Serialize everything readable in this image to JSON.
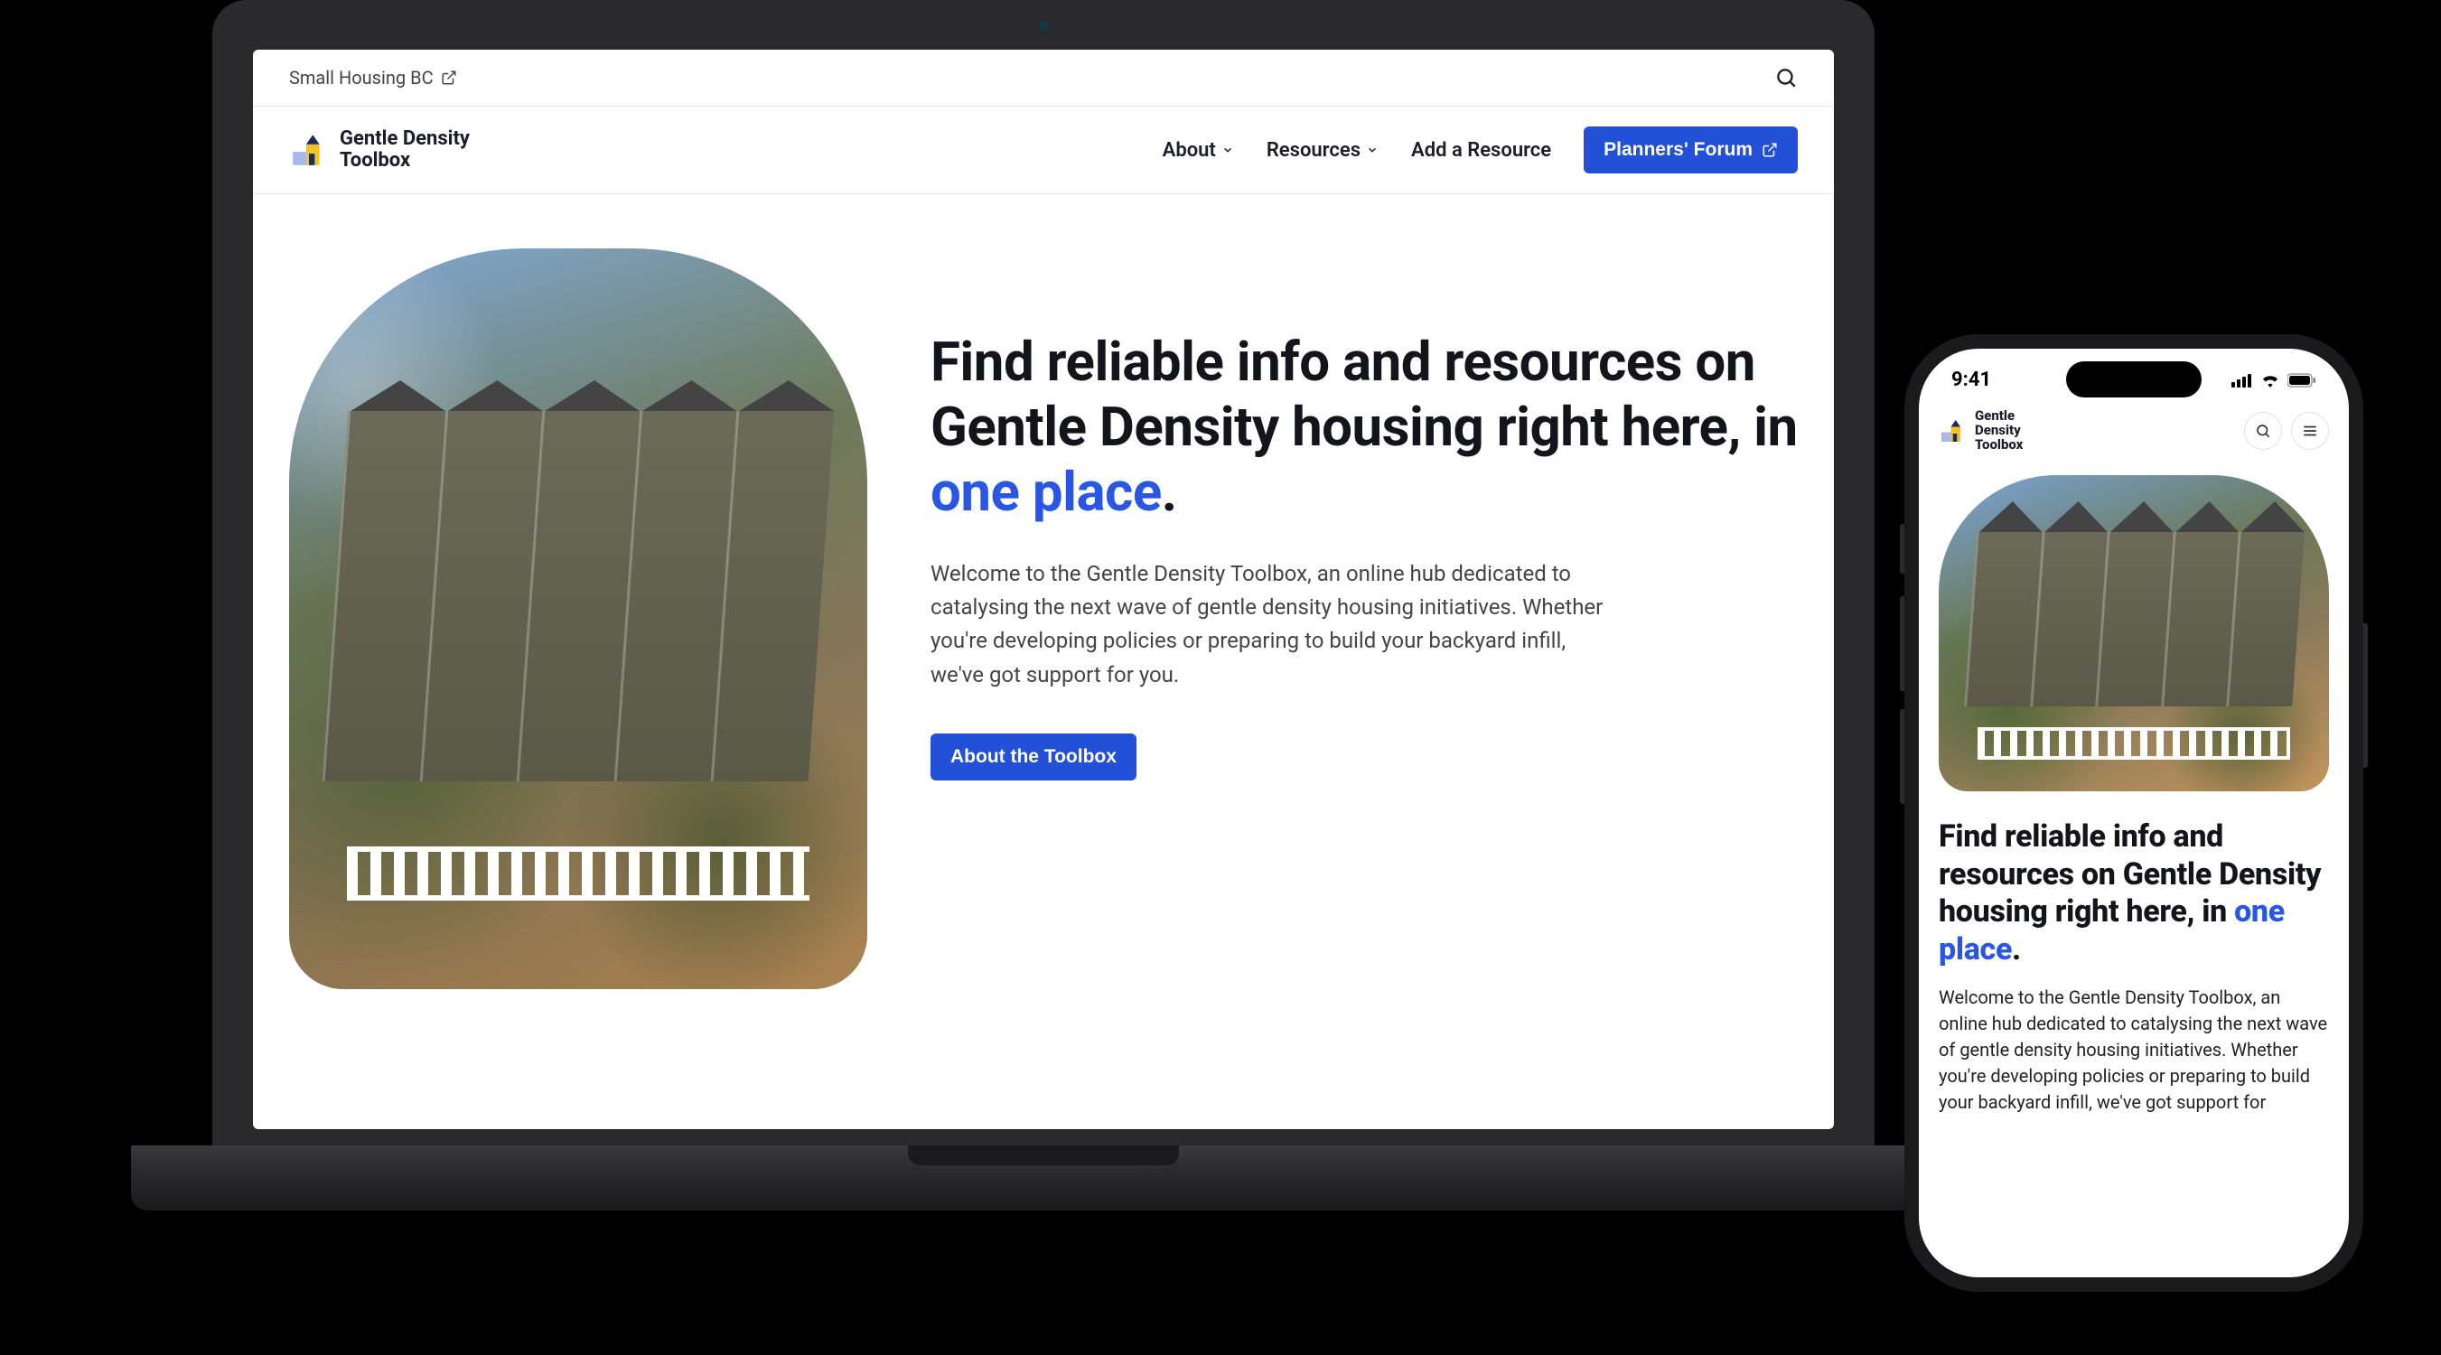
{
  "topbar": {
    "parent_org": "Small Housing BC"
  },
  "brand": {
    "line1": "Gentle Density",
    "line2": "Toolbox"
  },
  "nav": {
    "about": "About",
    "resources": "Resources",
    "add_resource": "Add a Resource",
    "planners_forum": "Planners' Forum"
  },
  "hero": {
    "headline_pre": "Find reliable info and resources on Gentle Density housing right here, in ",
    "headline_accent": "one place",
    "headline_post": ".",
    "body": "Welcome to the Gentle Density Toolbox, an online hub dedicated to catalysing the next wave of gentle density housing initiatives. Whether you're developing policies or preparing to build your backyard infill, we've got support for you.",
    "cta_label": "About the Toolbox"
  },
  "mobile": {
    "status_time": "9:41",
    "body": "Welcome to the Gentle Density Toolbox, an online hub dedicated to catalysing the next wave of gentle density housing initiatives.  Whether you're developing policies or preparing to build your backyard infill, we've got support for"
  },
  "colors": {
    "primary": "#2250d6",
    "accent_text": "#2956e4",
    "logo_yellow": "#f4c224",
    "logo_blue": "#a8b8ea"
  }
}
